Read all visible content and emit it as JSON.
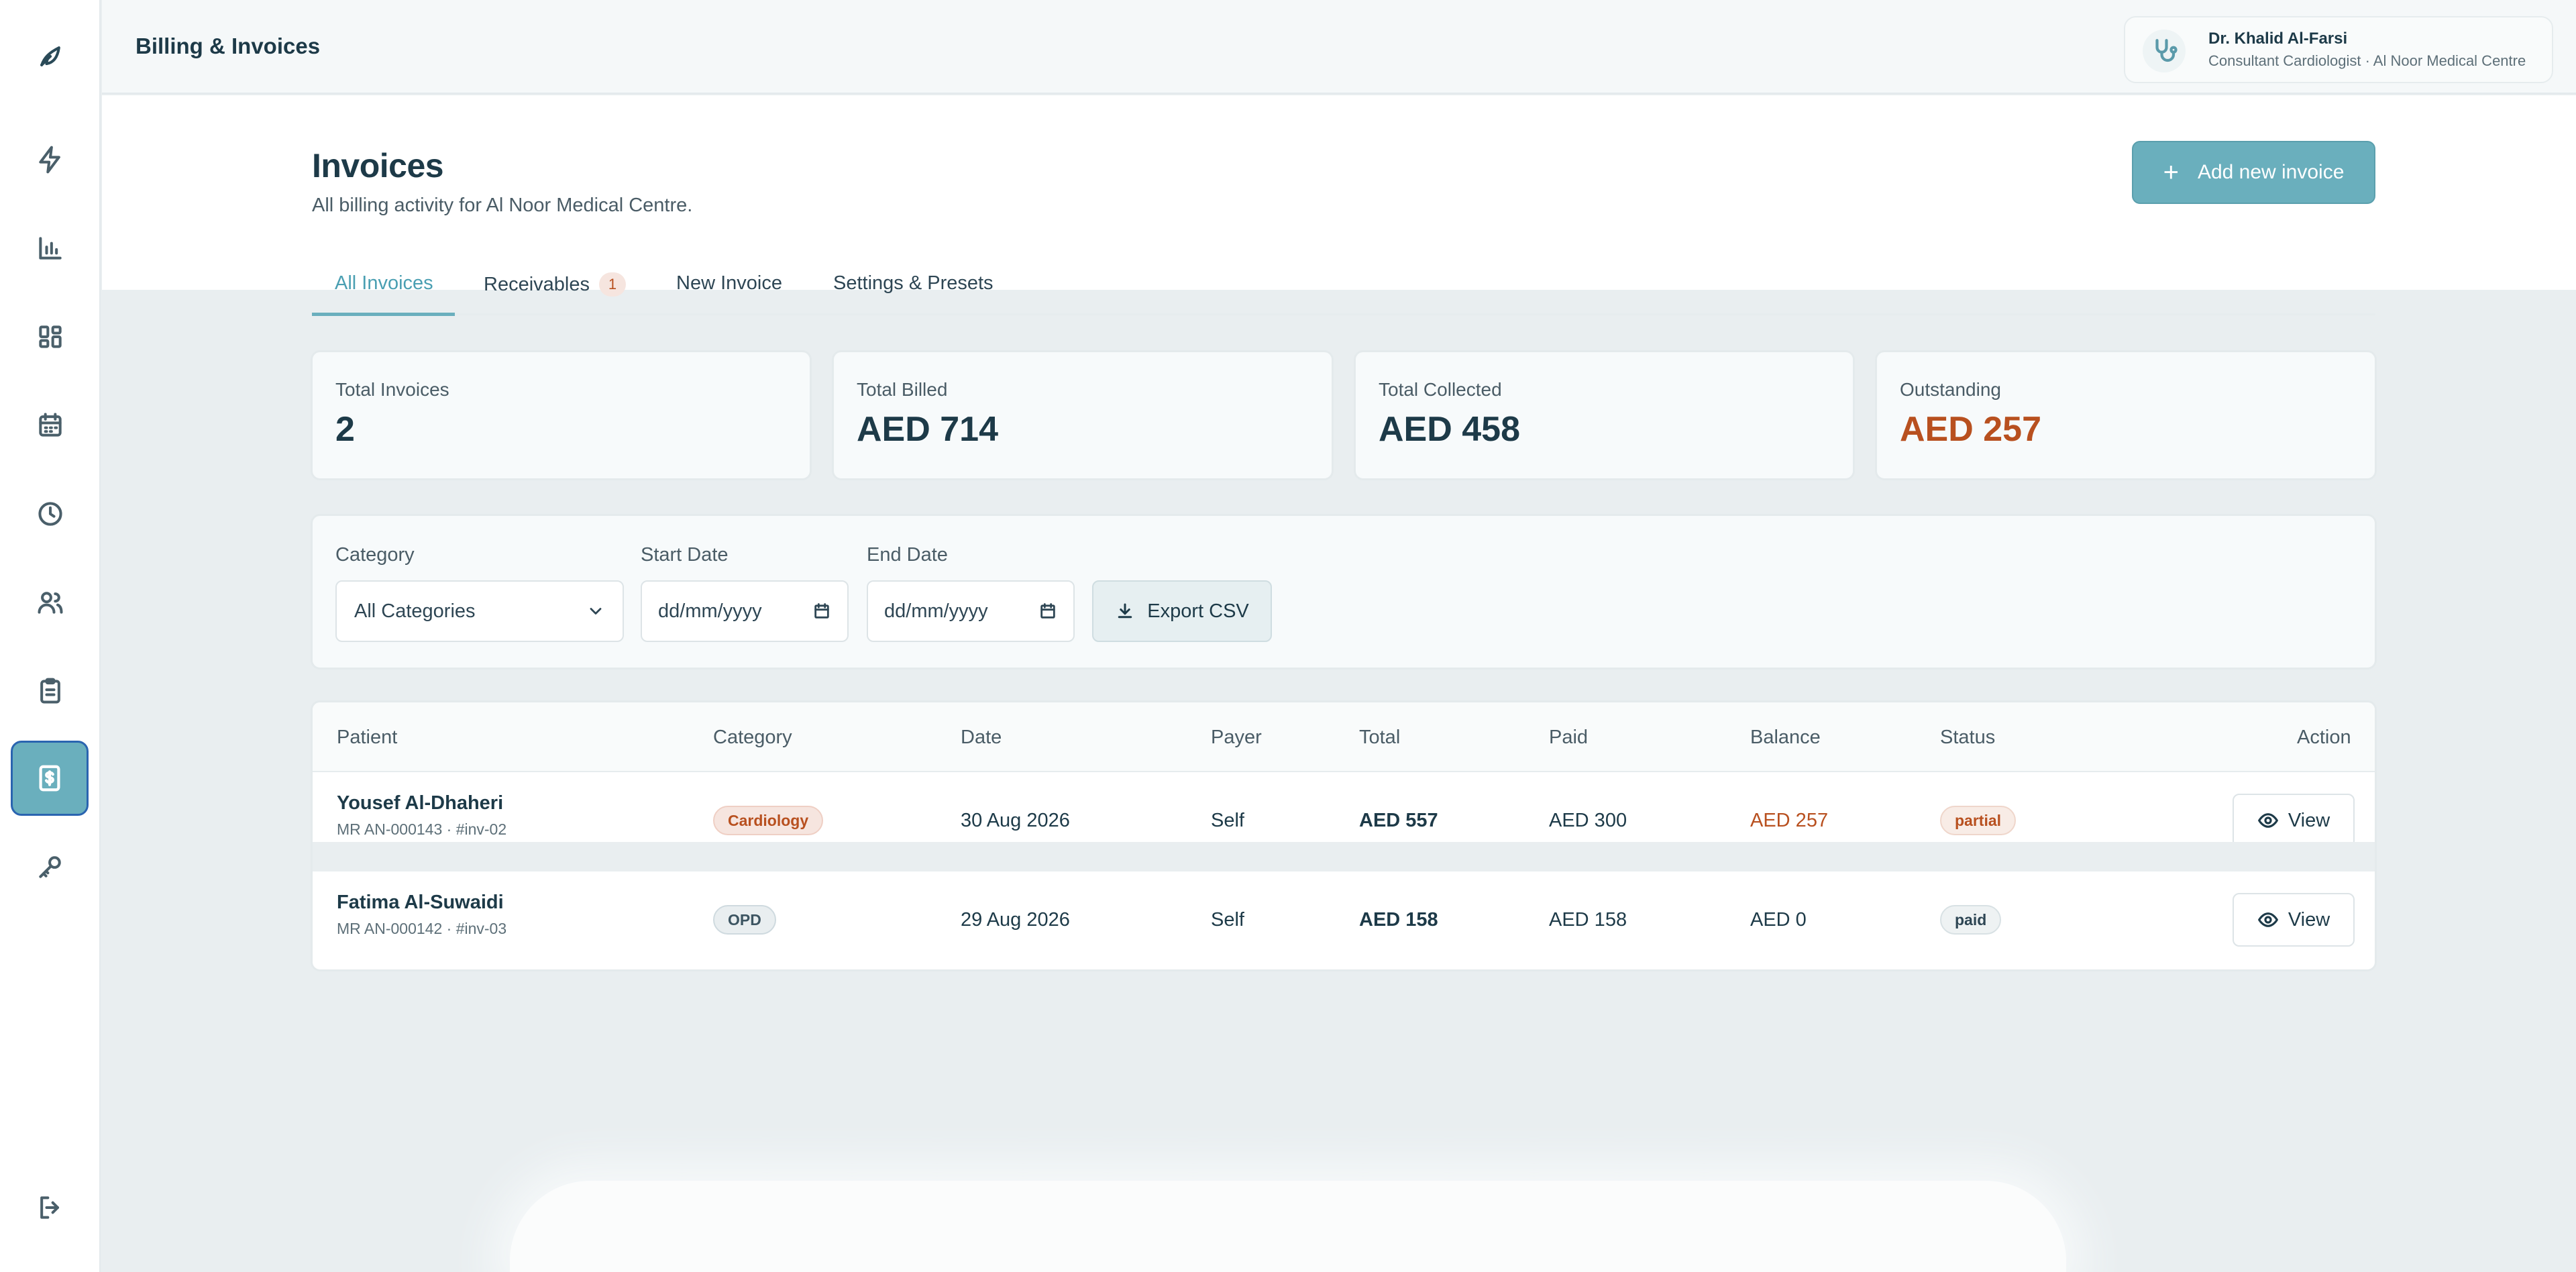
{
  "header": {
    "title": "Billing & Invoices",
    "user": {
      "name": "Dr. Khalid Al-Farsi",
      "role": "Consultant Cardiologist · Al Noor Medical Centre"
    }
  },
  "sidebar": {
    "icons": [
      "leaf-logo-icon",
      "bolt-icon",
      "bar-chart-icon",
      "grid-icon",
      "calendar-icon",
      "clock-icon",
      "users-icon",
      "clipboard-icon",
      "invoice-icon",
      "key-icon",
      "logout-icon"
    ],
    "active": "invoice-icon"
  },
  "page": {
    "title": "Invoices",
    "subtitle": "All billing activity for Al Noor Medical Centre.",
    "add_button": "Add new invoice"
  },
  "tabs": [
    {
      "label": "All Invoices",
      "active": true
    },
    {
      "label": "Receivables",
      "badge": "1"
    },
    {
      "label": "New Invoice"
    },
    {
      "label": "Settings & Presets"
    }
  ],
  "stats": [
    {
      "label": "Total Invoices",
      "value": "2"
    },
    {
      "label": "Total Billed",
      "value": "AED 714"
    },
    {
      "label": "Total Collected",
      "value": "AED 458"
    },
    {
      "label": "Outstanding",
      "value": "AED 257"
    }
  ],
  "filters": {
    "category_label": "Category",
    "category_value": "All Categories",
    "start_label": "Start Date",
    "start_placeholder": "dd/mm/yyyy",
    "end_label": "End Date",
    "end_placeholder": "dd/mm/yyyy",
    "export_label": "Export CSV"
  },
  "table": {
    "columns": [
      "Patient",
      "Category",
      "Date",
      "Payer",
      "Total",
      "Paid",
      "Balance",
      "Status",
      "Action"
    ],
    "rows": [
      {
        "patient": "Yousef Al-Dhaheri",
        "meta": "MR AN-000143 · #inv-02",
        "category": "Cardiology",
        "date": "30 Aug 2026",
        "payer": "Self",
        "total": "AED 557",
        "paid": "AED 300",
        "balance": "AED 257",
        "status": "partial",
        "action": "View"
      },
      {
        "patient": "Fatima Al-Suwaidi",
        "meta": "MR AN-000142 · #inv-03",
        "category": "OPD",
        "date": "29 Aug 2026",
        "payer": "Self",
        "total": "AED 158",
        "paid": "AED 158",
        "balance": "AED 0",
        "status": "paid",
        "action": "View"
      }
    ]
  },
  "colors": {
    "accent": "#6aafbd",
    "warning": "#b8501f",
    "text": "#1d3a48"
  }
}
